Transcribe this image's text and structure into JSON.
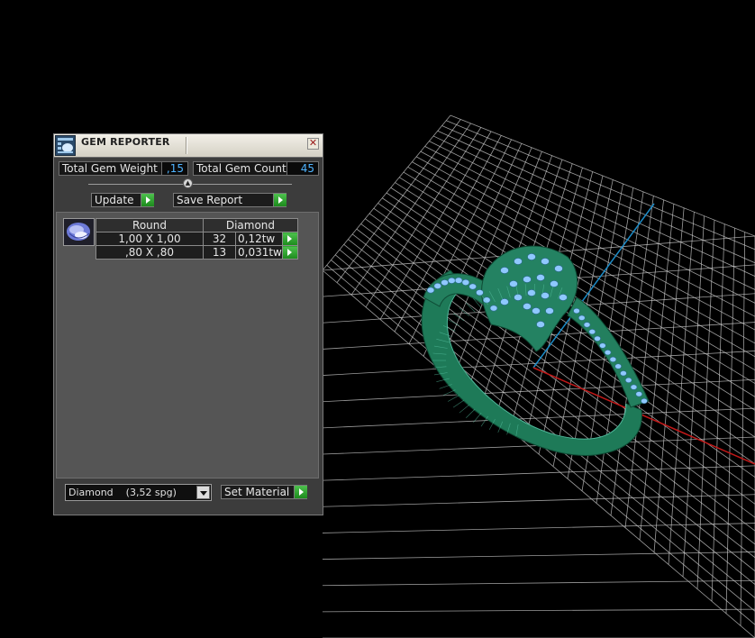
{
  "window": {
    "title": "GEM REPORTER",
    "icon": "gem-reporter-app-icon",
    "close_label": "✕"
  },
  "stats": {
    "total_weight_label": "Total Gem Weight",
    "total_weight_value": ",15",
    "total_count_label": "Total Gem Count",
    "total_count_value": "45"
  },
  "splitter": {
    "knob_glyph": "▲"
  },
  "actions": {
    "update_label": "Update",
    "save_report_label": "Save Report"
  },
  "gem_table": {
    "headers": [
      "Round",
      "Diamond"
    ],
    "rows": [
      {
        "size": "1,00 X 1,00",
        "count": "32",
        "weight": "0,12tw"
      },
      {
        "size": ",80 X ,80",
        "count": "13",
        "weight": "0,031tw"
      }
    ]
  },
  "material": {
    "selected": "Diamond    (3,52 spg)",
    "set_material_label": "Set Material"
  },
  "colors": {
    "grid_line": "#d0d0d0",
    "axis_x": "#c01818",
    "axis_y": "#1c8cc8",
    "ring_metal": "#1f7a5a",
    "gem": "#8fc8ff",
    "value_text": "#4fb4ff",
    "play_green": "#2aa02a"
  }
}
